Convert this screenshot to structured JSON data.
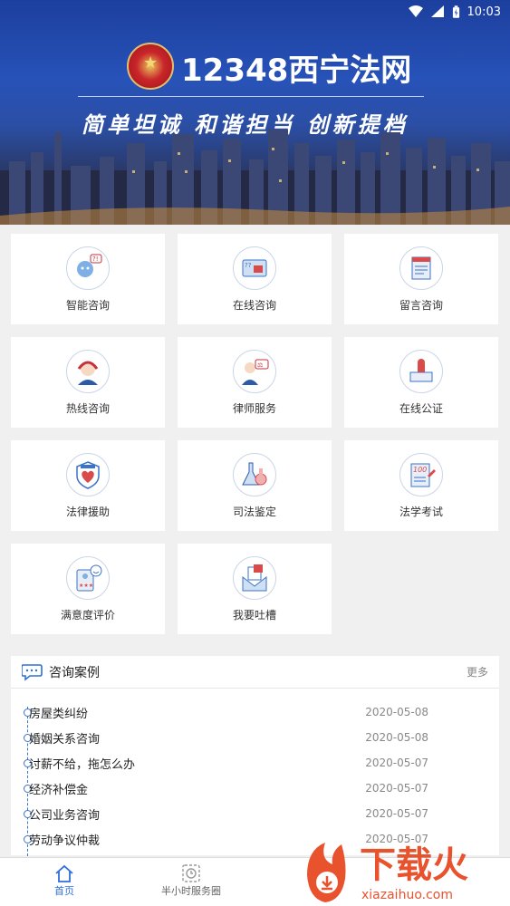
{
  "status_bar": {
    "time": "10:03"
  },
  "banner": {
    "title": "12348西宁法网",
    "slogan": "简单坦诚  和谐担当  创新提档"
  },
  "services": [
    {
      "label": "智能咨询",
      "icon": "robot-consult-icon"
    },
    {
      "label": "在线咨询",
      "icon": "online-consult-icon"
    },
    {
      "label": "留言咨询",
      "icon": "message-consult-icon"
    },
    {
      "label": "热线咨询",
      "icon": "hotline-icon"
    },
    {
      "label": "律师服务",
      "icon": "lawyer-icon"
    },
    {
      "label": "在线公证",
      "icon": "notary-stamp-icon"
    },
    {
      "label": "法律援助",
      "icon": "legal-aid-shield-icon"
    },
    {
      "label": "司法鉴定",
      "icon": "judicial-flask-icon"
    },
    {
      "label": "法学考试",
      "icon": "law-exam-icon"
    },
    {
      "label": "满意度评价",
      "icon": "satisfaction-icon"
    },
    {
      "label": "我要吐槽",
      "icon": "complaint-icon"
    }
  ],
  "cases": {
    "title": "咨询案例",
    "more": "更多",
    "items": [
      {
        "text": "房屋类纠纷",
        "date": "2020-05-08"
      },
      {
        "text": "婚姻关系咨询",
        "date": "2020-05-08"
      },
      {
        "text": "讨薪不给，拖怎么办",
        "date": "2020-05-07"
      },
      {
        "text": "经济补偿金",
        "date": "2020-05-07"
      },
      {
        "text": "公司业务咨询",
        "date": "2020-05-07"
      },
      {
        "text": "劳动争议仲裁",
        "date": "2020-05-07"
      }
    ]
  },
  "nav": {
    "home": "首页",
    "service_circle": "半小时服务圈"
  },
  "watermark": {
    "text": "下载火",
    "url": "xiazaihuo.com"
  },
  "colors": {
    "accent": "#2f6fd8",
    "banner": "#2752b8"
  }
}
